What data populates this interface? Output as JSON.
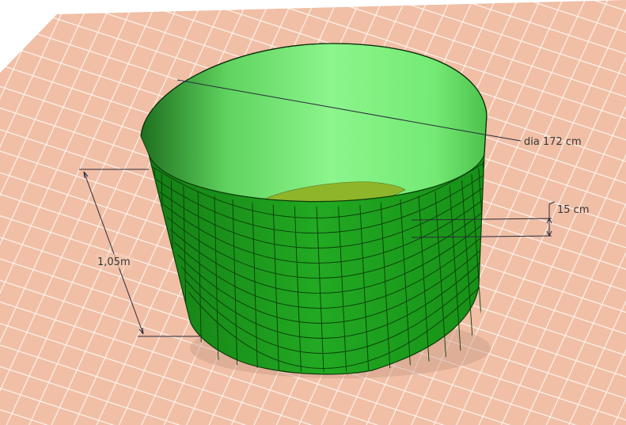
{
  "scene": {
    "object": "cylindrical tank",
    "colors": {
      "background": "#ffffff",
      "floor_tile": "#f3c8b0",
      "floor_grout": "#ffffff",
      "tank_outer": "#1fa31f",
      "tank_inner": "#7cf07c",
      "tank_bottom": "#8fb52a",
      "mesh_lines": "#0a3d0a",
      "dimension_lines": "#2a2a3a"
    }
  },
  "dimensions": {
    "diameter_label": "dia 172 cm",
    "height_label": "1,05m",
    "band_label": "15 cm"
  }
}
